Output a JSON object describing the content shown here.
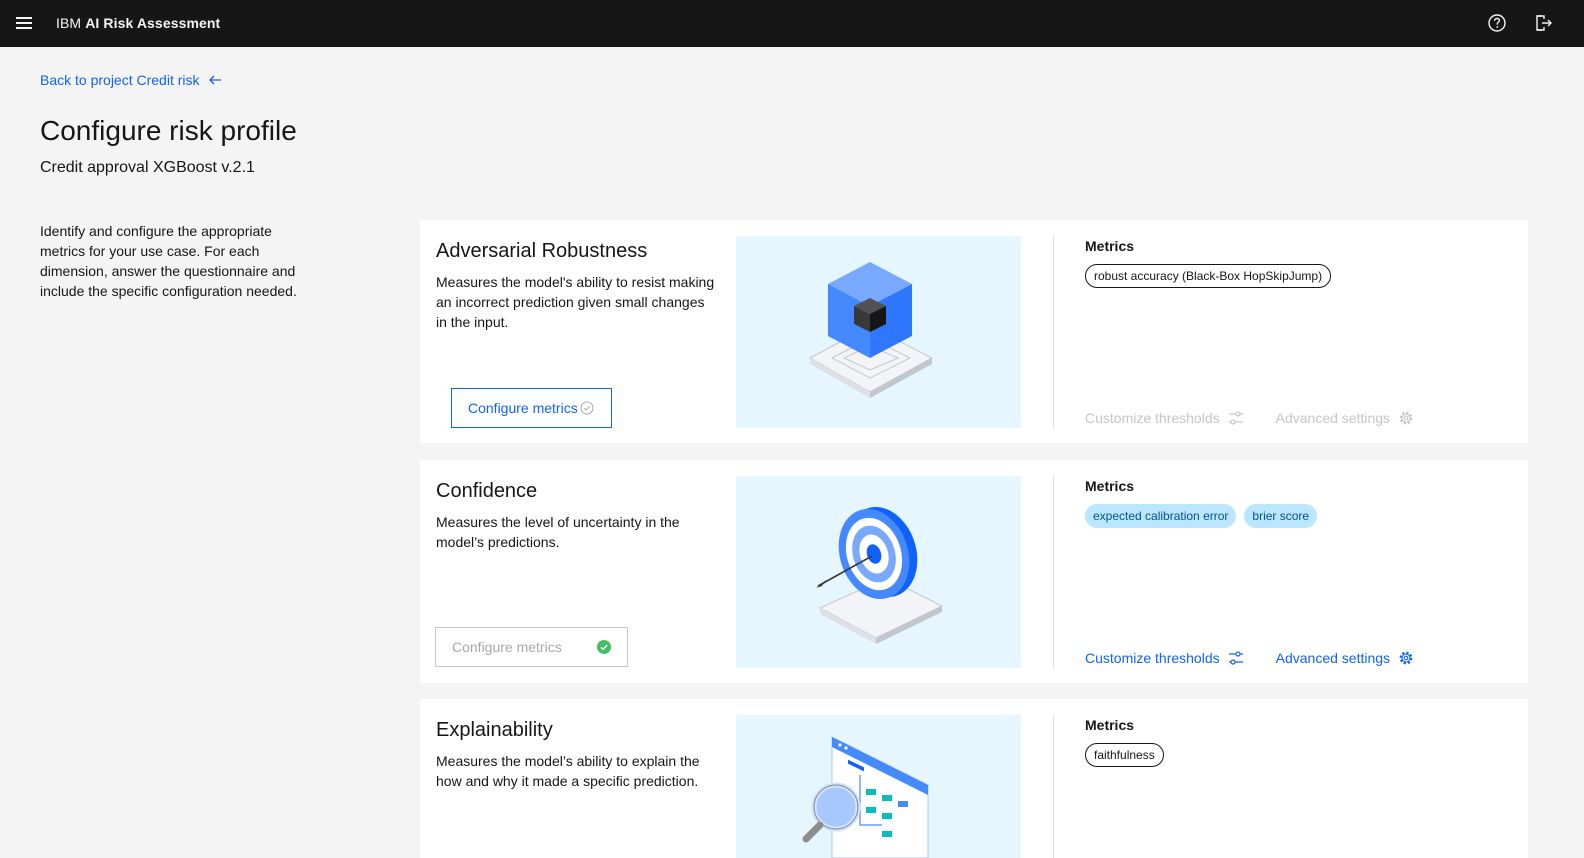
{
  "header": {
    "brand_prefix": "IBM",
    "brand_name": "AI Risk Assessment",
    "menu_icon": "hamburger-menu-icon",
    "help_icon": "help-icon",
    "logout_icon": "logout-icon"
  },
  "nav": {
    "back_label": "Back to project Credit risk",
    "back_icon": "arrow-left-icon"
  },
  "page": {
    "title": "Configure risk profile",
    "subtitle": "Credit approval XGBoost v.2.1",
    "intro": "Identify and configure the appropriate metrics for your use case. For each dimension, answer the questionnaire and include the specific configuration needed."
  },
  "colors": {
    "accent": "#0f62fe",
    "tag_blue_bg": "#bae6ff",
    "success_green": "#24a148",
    "header_bg": "#161616",
    "illustration_bg": "#e5f6ff"
  },
  "cards": [
    {
      "title": "Adversarial Robustness",
      "description": "Measures the model's ability to resist making an incorrect prediction given small changes in the input.",
      "button_label": "Configure metrics",
      "button_state": "active",
      "metrics_label": "Metrics",
      "tags": [
        "robust accuracy (Black-Box HopSkipJump)"
      ],
      "tag_style": "outline",
      "customize_label": "Customize thresholds",
      "advanced_label": "Advanced settings",
      "actions_state": "disabled"
    },
    {
      "title": "Confidence",
      "description": "Measures the level of uncertainty in the model’s predictions.",
      "button_label": "Configure metrics",
      "button_state": "disabled",
      "metrics_label": "Metrics",
      "tags": [
        "expected calibration error",
        "brier score"
      ],
      "tag_style": "blue",
      "customize_label": "Customize thresholds",
      "advanced_label": "Advanced settings",
      "actions_state": "active"
    },
    {
      "title": "Explainability",
      "description": "Measures the model’s ability to explain the how and why it made a specific prediction.",
      "metrics_label": "Metrics",
      "tags": [
        "faithfulness"
      ],
      "tag_style": "outline"
    }
  ]
}
